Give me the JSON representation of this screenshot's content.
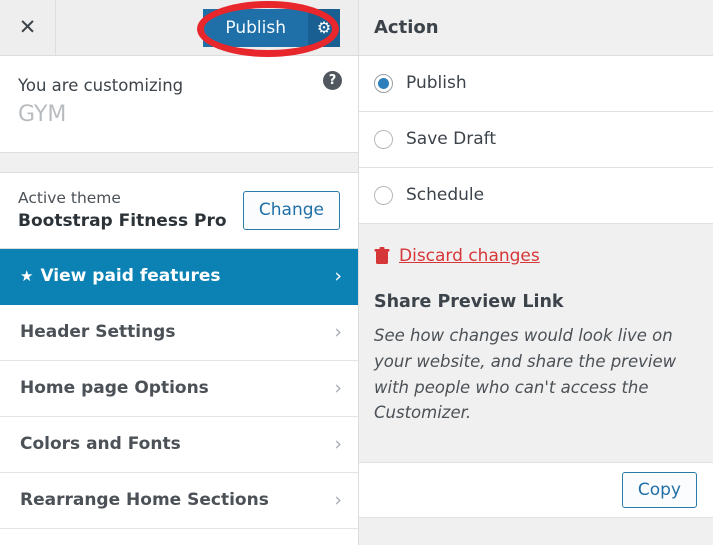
{
  "topbar": {
    "close_icon": "close-icon",
    "publish_label": "Publish",
    "gear_icon": "gear-icon",
    "publish_button_color": "#1f6fa8",
    "gear_button_color": "#1a5f92",
    "annotation_color": "#e8272c"
  },
  "customizing": {
    "heading": "You are customizing",
    "site_title": "GYM",
    "help_icon_label": "?"
  },
  "theme": {
    "active_label": "Active theme",
    "name": "Bootstrap Fitness Pro",
    "change_label": "Change"
  },
  "nav": {
    "items": [
      {
        "label": "View paid features",
        "featured": true,
        "star": "★",
        "chevron": "›"
      },
      {
        "label": "Header Settings",
        "featured": false,
        "chevron": "›"
      },
      {
        "label": "Home page Options",
        "featured": false,
        "chevron": "›"
      },
      {
        "label": "Colors and Fonts",
        "featured": false,
        "chevron": "›"
      },
      {
        "label": "Rearrange Home Sections",
        "featured": false,
        "chevron": "›"
      }
    ],
    "featured_color": "#0c82b4"
  },
  "action_panel": {
    "title": "Action",
    "options": [
      {
        "label": "Publish",
        "selected": true
      },
      {
        "label": "Save Draft",
        "selected": false
      },
      {
        "label": "Schedule",
        "selected": false
      }
    ],
    "discard": {
      "label": "Discard changes",
      "icon": "trash-icon",
      "color": "#d63638"
    },
    "share": {
      "title": "Share Preview Link",
      "description": "See how changes would look live on your website, and share the preview with people who can't access the Customizer.",
      "copy_label": "Copy"
    }
  }
}
